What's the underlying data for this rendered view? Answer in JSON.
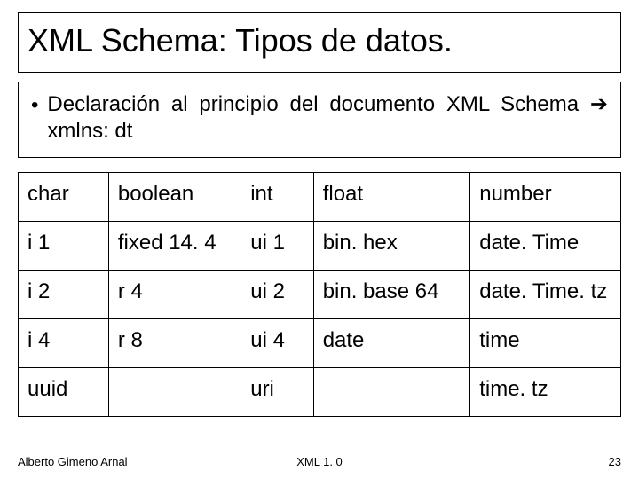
{
  "title": "XML Schema: Tipos de datos.",
  "bullet": {
    "prefix": "Declaración al principio del documento XML Schema ",
    "arrow": "➔",
    "suffix": " xmlns: dt"
  },
  "table": {
    "rows": [
      [
        "char",
        "boolean",
        "int",
        "float",
        "number"
      ],
      [
        "i 1",
        "fixed 14. 4",
        "ui 1",
        "bin. hex",
        "date. Time"
      ],
      [
        "i 2",
        "r 4",
        "ui 2",
        "bin. base 64",
        "date. Time. tz"
      ],
      [
        "i 4",
        "r 8",
        "ui 4",
        "date",
        "time"
      ],
      [
        "uuid",
        "",
        "uri",
        "",
        "time. tz"
      ]
    ]
  },
  "footer": {
    "author": "Alberto Gimeno Arnal",
    "center": "XML 1. 0",
    "page": "23"
  }
}
